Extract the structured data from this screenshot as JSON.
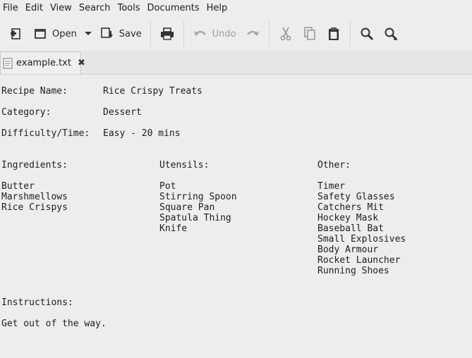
{
  "menu": [
    "File",
    "Edit",
    "View",
    "Search",
    "Tools",
    "Documents",
    "Help"
  ],
  "toolbar": {
    "open_label": "Open",
    "save_label": "Save",
    "undo_label": "Undo"
  },
  "tab": {
    "filename": "example.txt",
    "close_glyph": "✖"
  },
  "document": {
    "recipe_name_label": "Recipe Name:",
    "recipe_name": "Rice Crispy Treats",
    "category_label": "Category:",
    "category": "Dessert",
    "difficulty_label": "Difficulty/Time:",
    "difficulty": "Easy - 20 mins",
    "ingredients_heading": "Ingredients:",
    "utensils_heading": "Utensils:",
    "other_heading": "Other:",
    "ingredients": [
      "Butter",
      "Marshmellows",
      "Rice Crispys"
    ],
    "utensils": [
      "Pot",
      "Stirring Spoon",
      "Square Pan",
      "Spatula Thing",
      "Knife"
    ],
    "other": [
      "Timer",
      "Safety Glasses",
      "Catchers Mit",
      "Hockey Mask",
      "Baseball Bat",
      "Small Explosives",
      "Body Armour",
      "Rocket Launcher",
      "Running Shoes"
    ],
    "instructions_heading": "Instructions:",
    "instructions": "Get out of the way."
  }
}
